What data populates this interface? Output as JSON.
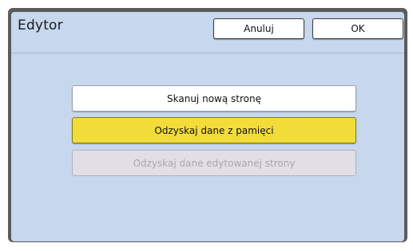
{
  "dialog": {
    "title": "Edytor",
    "cancel_label": "Anuluj",
    "ok_label": "OK"
  },
  "options": {
    "scan_new_page": "Skanuj nową stronę",
    "recover_from_memory": "Odzyskaj dane z pamięci",
    "recover_edited_page": "Odzyskaj dane edytowanej strony"
  },
  "colors": {
    "panel_background": "#c6d7ee",
    "selected_option": "#f2dc3a",
    "disabled_option": "#e3dee5"
  }
}
